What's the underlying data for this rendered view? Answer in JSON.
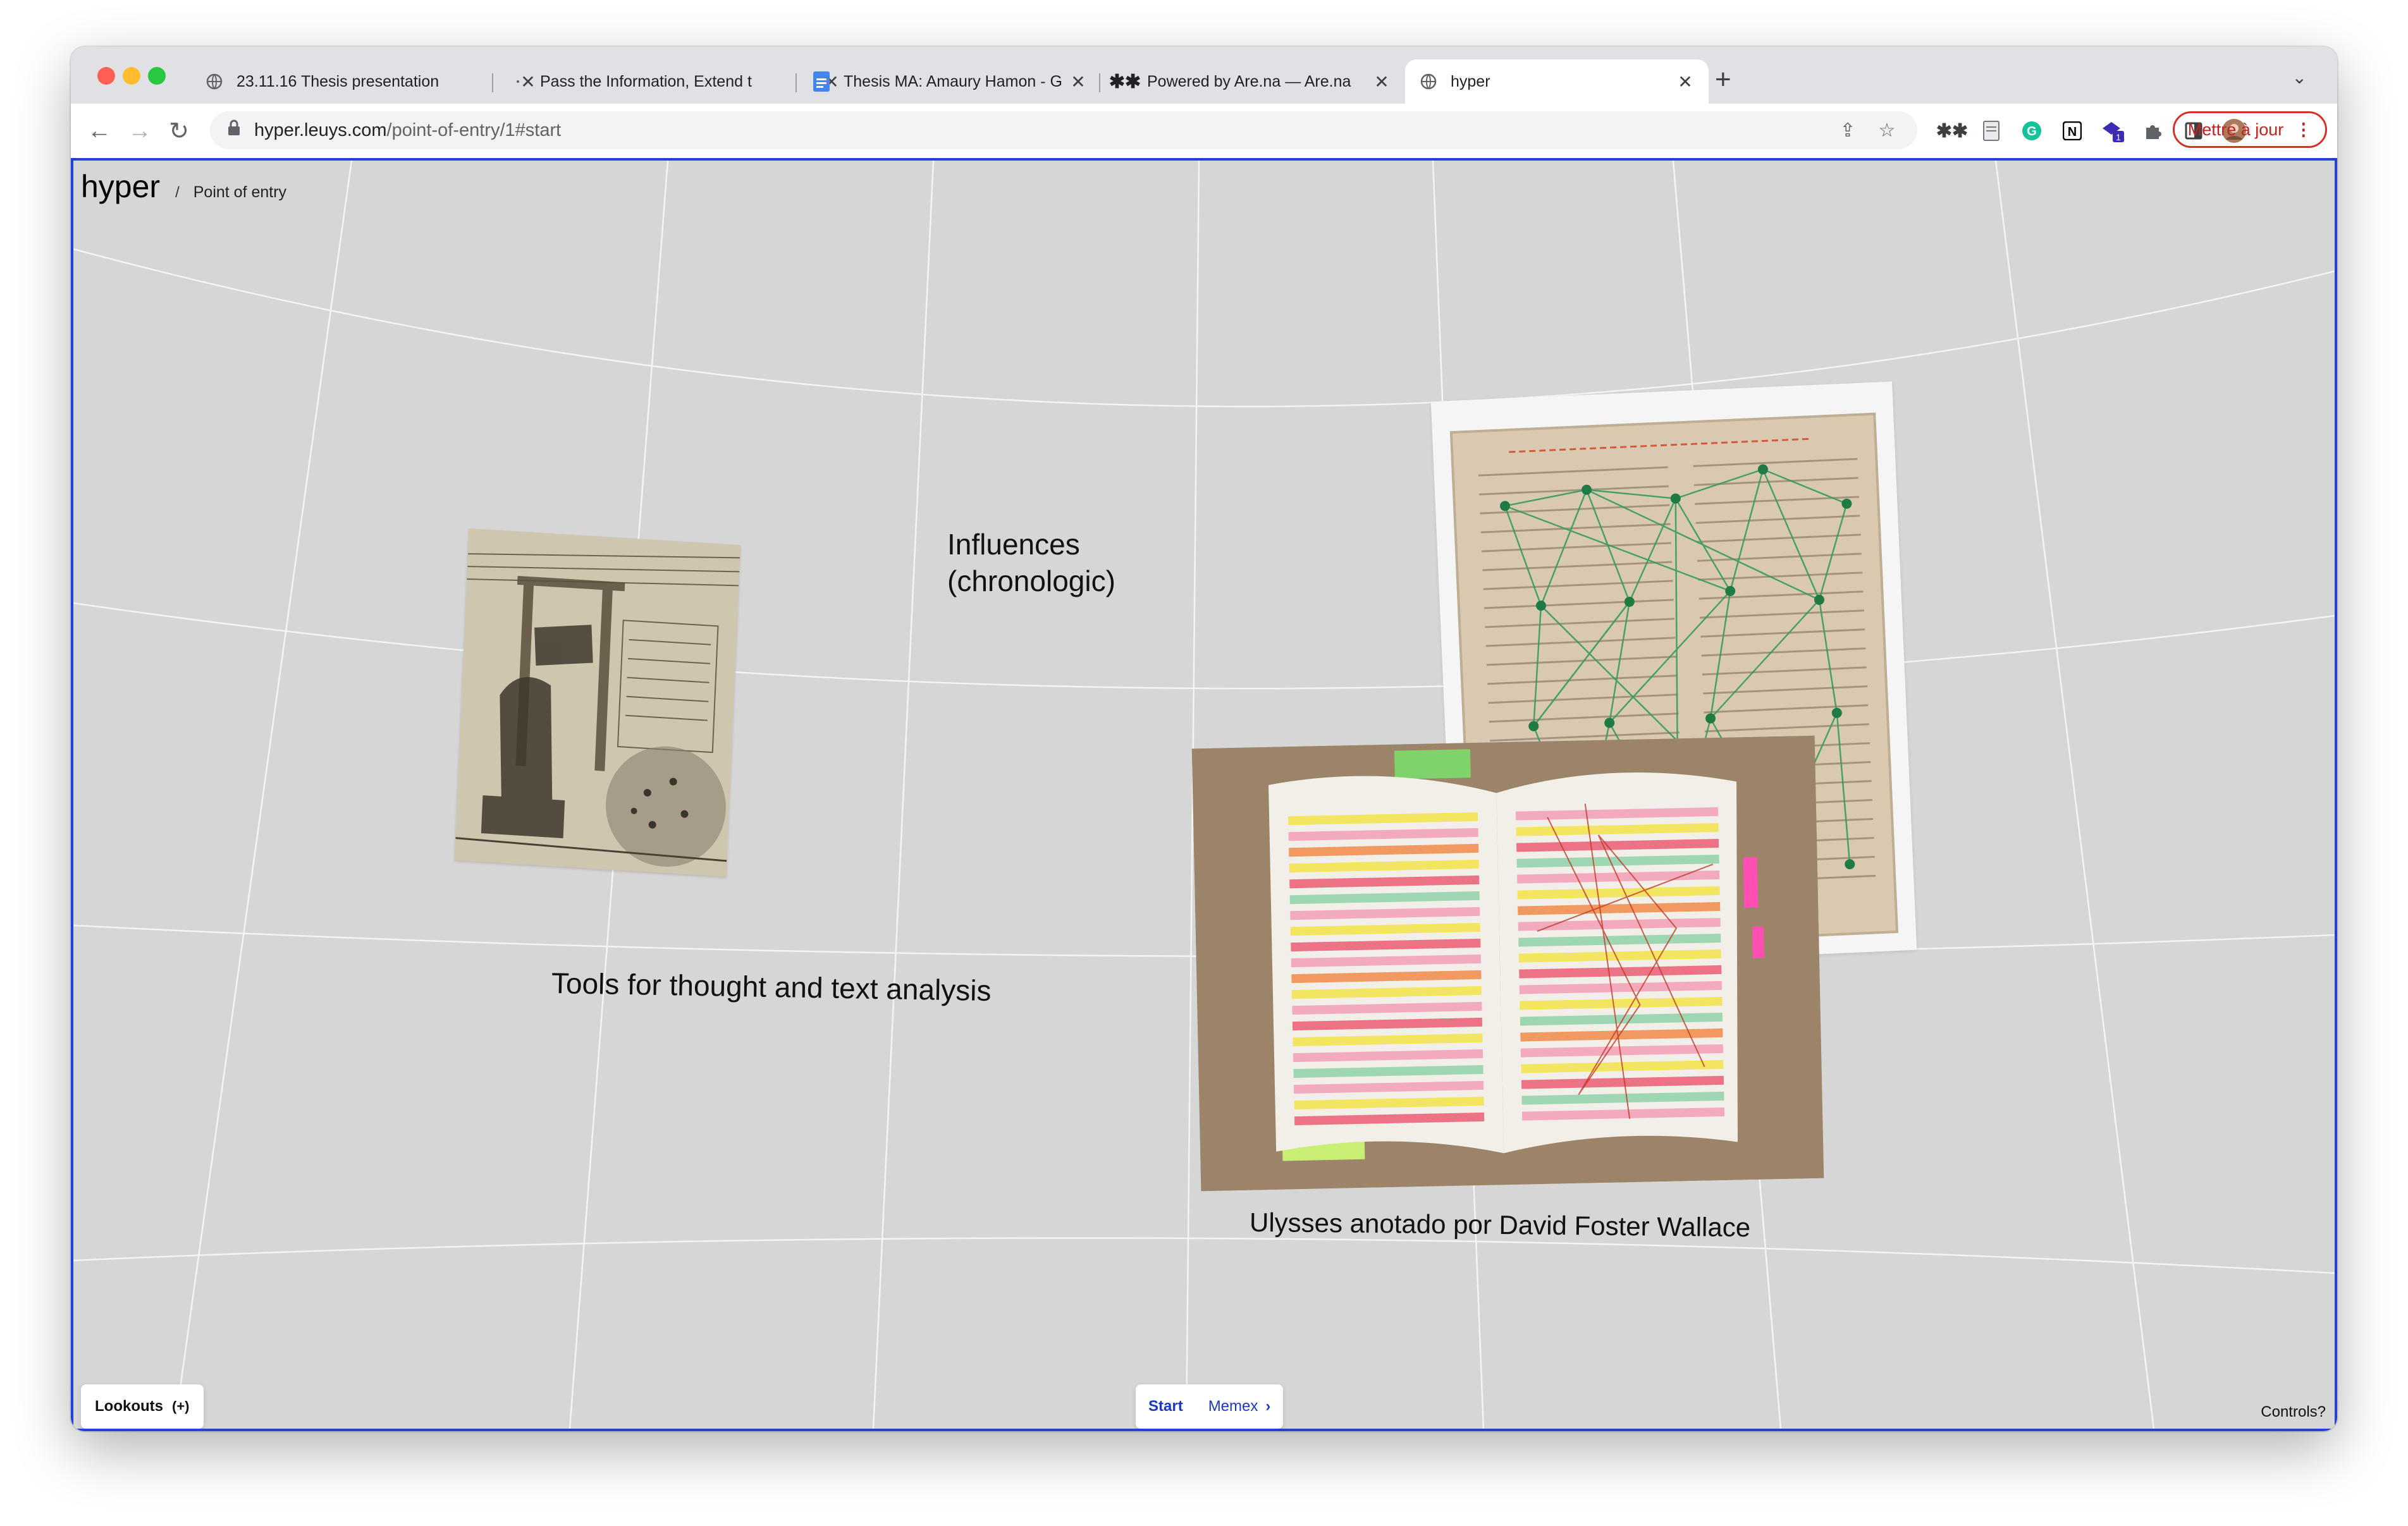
{
  "browser": {
    "tabs": [
      {
        "title": "23.11.16 Thesis presentation",
        "favicon": "globe-icon"
      },
      {
        "title": "Pass the Information, Extend t",
        "favicon": "dot-icon"
      },
      {
        "title": "Thesis MA: Amaury Hamon - G",
        "favicon": "google-docs-icon"
      },
      {
        "title": "Powered by Are.na — Are.na",
        "favicon": "arena-icon"
      },
      {
        "title": "hyper",
        "favicon": "globe-icon",
        "active": true
      }
    ],
    "url_host": "hyper.leuys.com",
    "url_path": "/point-of-entry/1#start",
    "update_label": "Mettre à jour",
    "extension_badge": "1"
  },
  "app": {
    "logo": "hyper",
    "breadcrumb_sep": "/",
    "breadcrumb": "Point of entry",
    "canvas": {
      "influences_line1": "Influences",
      "influences_line2": "(chronologic)",
      "tools_caption": "Tools for thought and text analysis",
      "ulysses_caption": "Ulysses anotado por David Foster Wallace"
    },
    "bottom": {
      "lookouts": "Lookouts",
      "lookouts_plus": "(+)",
      "start": "Start",
      "memex": "Memex",
      "controls": "Controls?"
    }
  },
  "colors": {
    "viewport_border": "#2340d8",
    "canvas_bg": "#d6d6d6",
    "accent_blue": "#1d37c9",
    "update_red": "#d93025"
  }
}
